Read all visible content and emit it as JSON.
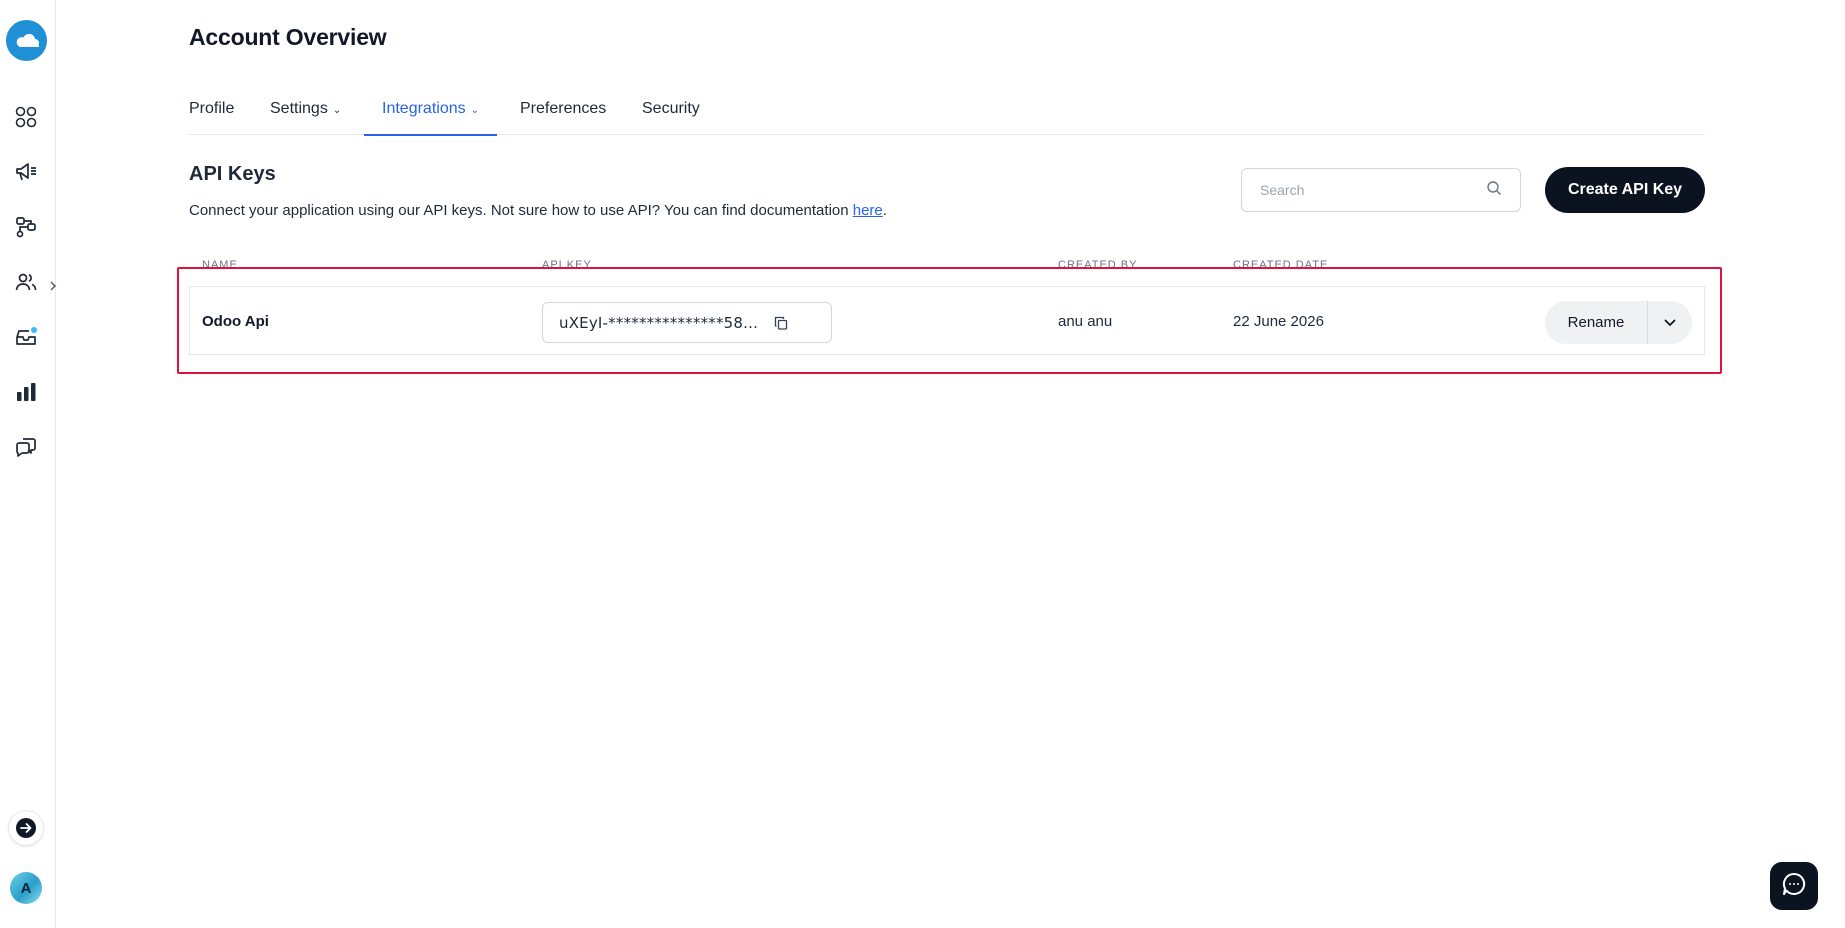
{
  "sidebar": {
    "logo_icon": "cloud-logo-icon",
    "items": [
      {
        "icon": "dashboard-grid-icon"
      },
      {
        "icon": "megaphone-campaigns-icon"
      },
      {
        "icon": "automation-flow-icon"
      },
      {
        "icon": "contacts-users-icon"
      },
      {
        "icon": "inbox-icon"
      },
      {
        "icon": "analytics-bar-chart-icon"
      },
      {
        "icon": "conversations-icon"
      }
    ],
    "expand_icon": "chevron-right-icon",
    "avatar_initial": "A"
  },
  "header": {
    "title": "Account Overview"
  },
  "tabs": [
    {
      "label": "Profile",
      "active": false,
      "has_dropdown": false
    },
    {
      "label": "Settings",
      "active": false,
      "has_dropdown": true
    },
    {
      "label": "Integrations",
      "active": true,
      "has_dropdown": true
    },
    {
      "label": "Preferences",
      "active": false,
      "has_dropdown": false
    },
    {
      "label": "Security",
      "active": false,
      "has_dropdown": false
    }
  ],
  "api_keys": {
    "title": "API Keys",
    "description_prefix": "Connect your application using our API keys. Not sure how to use API? You can find documentation ",
    "description_link": "here",
    "description_suffix": ".",
    "search_placeholder": "Search",
    "create_button": "Create API Key",
    "columns": [
      "NAME",
      "API KEY",
      "CREATED BY",
      "CREATED DATE"
    ],
    "rows": [
      {
        "name": "Odoo Api",
        "api_key": "uXEyI-***************58...",
        "created_by": "anu anu",
        "created_date": "22 June 2026",
        "action_label": "Rename"
      }
    ]
  },
  "colors": {
    "accent": "#2563eb",
    "dark_button": "#0b1220",
    "highlight_border": "#dc143c",
    "logo": "#1f8fd6"
  }
}
